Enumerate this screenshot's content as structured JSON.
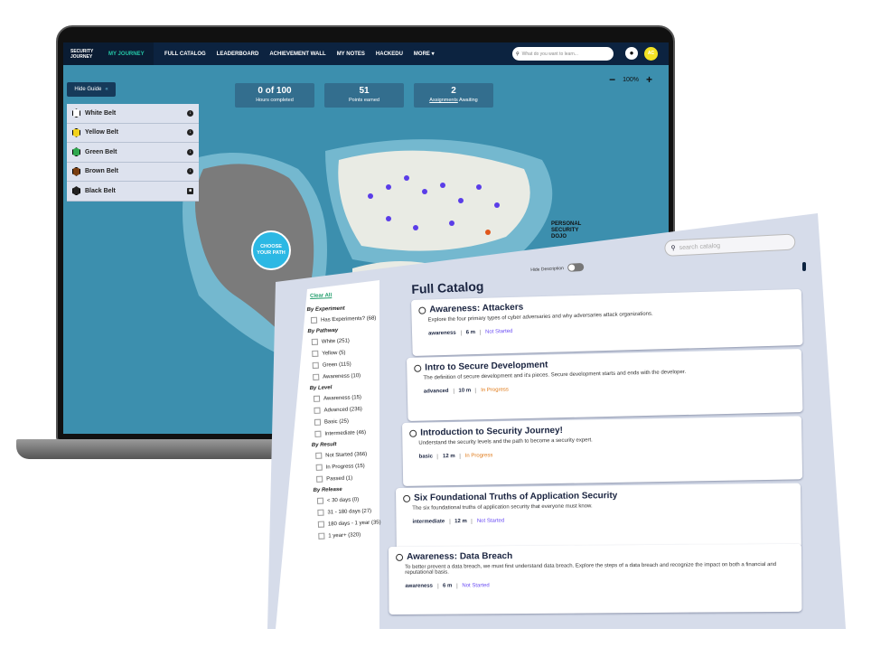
{
  "nav": {
    "logo": "SECURITY JOURNEY",
    "items": [
      "MY JOURNEY",
      "FULL CATALOG",
      "LEADERBOARD",
      "ACHIEVEMENT WALL",
      "MY NOTES",
      "HACKEDU",
      "MORE ▾"
    ],
    "search_placeholder": "What do you want to learn...",
    "avatar": "AC"
  },
  "stats": [
    {
      "value": "0 of 100",
      "label": "Hours completed"
    },
    {
      "value": "51",
      "label": "Points earned"
    },
    {
      "value": "2",
      "label_link": "Assignments",
      "label": " Awaiting"
    }
  ],
  "zoom": {
    "minus": "−",
    "level": "100%",
    "plus": "+"
  },
  "guide": {
    "hide_label": "Hide Guide",
    "belts": [
      {
        "name": "White Belt",
        "color": "#ffffff",
        "icon": "download-icon"
      },
      {
        "name": "Yellow Belt",
        "color": "#f2d21b",
        "icon": "download-icon"
      },
      {
        "name": "Green Belt",
        "color": "#2fa84f",
        "icon": "download-icon"
      },
      {
        "name": "Brown Belt",
        "color": "#7a3f12",
        "icon": "download-icon"
      },
      {
        "name": "Black Belt",
        "color": "#222222",
        "icon": "lock-icon"
      }
    ]
  },
  "map": {
    "choose_path": "CHOOSE YOUR PATH",
    "dojo": "PERSONAL SECURITY DOJO"
  },
  "catalog": {
    "title": "Full Catalog",
    "hide_description": "Hide Description",
    "search_placeholder": "search catalog",
    "clear_all": "Clear All",
    "filter_groups": [
      {
        "title": "By Experiment",
        "options": [
          "Has Experiments? (68)"
        ]
      },
      {
        "title": "By Pathway",
        "options": [
          "White (251)",
          "Yellow (5)",
          "Green (115)",
          "Awareness (10)"
        ]
      },
      {
        "title": "By Level",
        "options": [
          "Awareness (15)",
          "Advanced (236)",
          "Basic (25)",
          "Intermediate (46)"
        ]
      },
      {
        "title": "By Result",
        "options": [
          "Not Started (366)",
          "In Progress (15)",
          "Passed (1)"
        ]
      },
      {
        "title": "By Release",
        "options": [
          "< 30 days (0)",
          "31 - 180 days (27)",
          "180 days - 1 year (35)",
          "1 year+ (320)"
        ]
      }
    ],
    "cards": [
      {
        "title": "Awareness: Attackers",
        "desc": "Explore the four primary types of cyber adversaries and why adversaries attack organizations.",
        "level": "awareness",
        "time": "6 m",
        "status": "Not Started"
      },
      {
        "title": "Intro to Secure Development",
        "desc": "The definition of secure development and it's pieces. Secure development starts and ends with the developer.",
        "level": "advanced",
        "time": "10 m",
        "status": "In Progress"
      },
      {
        "title": "Introduction to Security Journey!",
        "desc": "Understand the security levels and the path to become a security expert.",
        "level": "basic",
        "time": "12 m",
        "status": "In Progress"
      },
      {
        "title": "Six Foundational Truths of Application Security",
        "desc": "The six foundational truths of application security that everyone must know.",
        "level": "intermediate",
        "time": "12 m",
        "status": "Not Started"
      },
      {
        "title": "Awareness: Data Breach",
        "desc": "To better prevent a data breach, we must first understand data breach. Explore the steps of a data breach and recognize the impact on both a financial and reputational basis.",
        "level": "awareness",
        "time": "6 m",
        "status": "Not Started"
      }
    ]
  }
}
